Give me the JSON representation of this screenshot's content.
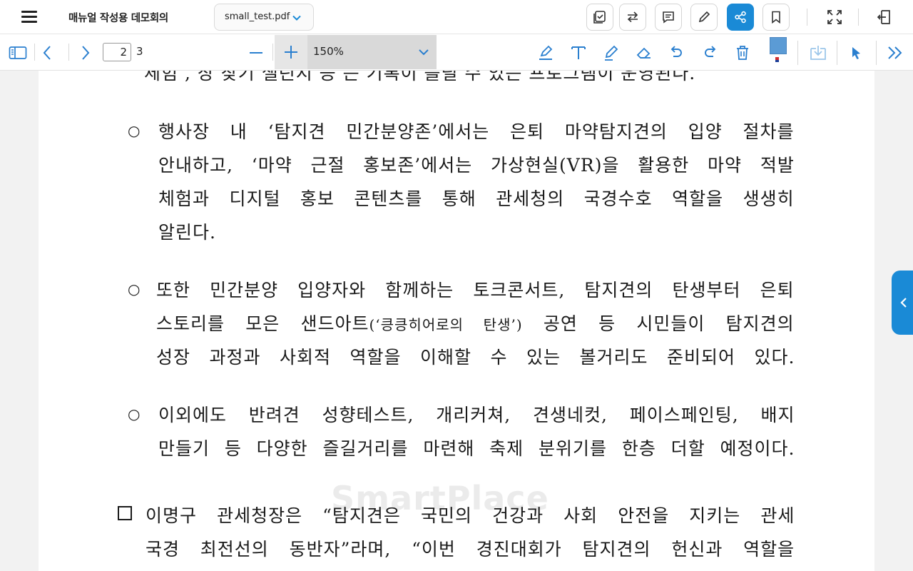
{
  "app": {
    "title": "매뉴얼 작성용 데모회의",
    "file_name": "small_test.pdf"
  },
  "toolbar": {
    "page_current": "2",
    "page_total": "3",
    "zoom": "150%",
    "annotation_color": "#5b9bd5",
    "accent_color": "#1a8ad6"
  },
  "icons": {
    "menu": "hamburger-menu-icon",
    "file_dropdown": "chevron-down-icon",
    "checklist": "checklist-icon",
    "swap": "swap-arrows-icon",
    "comment": "comment-icon",
    "pen": "pencil-icon",
    "share": "share-icon",
    "bookmark": "bookmark-icon",
    "fullscreen": "fullscreen-icon",
    "exit": "exit-icon",
    "sidebar": "sidebar-toggle-icon",
    "prev": "chevron-left-icon",
    "next": "chevron-right-icon",
    "zoom_out": "minus-icon",
    "zoom_in": "plus-icon",
    "highlighter": "highlighter-icon",
    "text": "text-tool-icon",
    "draw": "draw-pen-icon",
    "eraser": "eraser-icon",
    "undo": "undo-icon",
    "redo": "redo-icon",
    "trash": "trash-icon",
    "save": "save-download-icon",
    "pointer": "pointer-cursor-icon",
    "expand": "double-chevron-right-icon",
    "side_panel": "side-panel-chevron-icon"
  },
  "document": {
    "watermark": "SmartPlace",
    "cut_line": "체험 , 장 찾기 챌린지 등 는 기록이 틀릴 수 있는 프로그램이 운영된다.",
    "bullets": [
      {
        "lines": [
          "행사장 내 ‘탐지견 민간분양존’에서는 은퇴 마약탐지견의 입양 절차를",
          "안내하고, ‘마약 근절 홍보존’에서는 가상현실(VR)을 활용한 마약 적발",
          "체험과 디지털 홍보 콘텐츠를 통해 관세청의 국경수호 역할을 생생히",
          "알린다."
        ]
      },
      {
        "lines": [
          "또한 민간분양 입양자와 함께하는 토크콘서트, 탐지견의 탄생부터 은퇴",
          "성장 과정과 사회적 역할을 이해할 수 있는 볼거리도 준비되어 있다."
        ],
        "line2_pre": "스토리를 모은 샌드아트",
        "line2_small": "(‘킁킁히어로의 탄생’)",
        "line2_post": " 공연 등 시민들이 탐지견의"
      },
      {
        "lines": [
          "이외에도 반려견 성향테스트, 개리커쳐, 견생네컷, 페이스페인팅, 배지",
          "만들기 등 다양한 즐길거리를 마련해 축제 분위기를 한층 더할 예정이다."
        ]
      }
    ],
    "box_item": {
      "lines": [
        "이명구 관세청장은 “탐지견은 국민의 건강과 사회 안전을 지키는 관세",
        "국경 최전선의 동반자”라며, “이번 경진대회가 탐지견의 헌신과 역할을"
      ]
    }
  }
}
